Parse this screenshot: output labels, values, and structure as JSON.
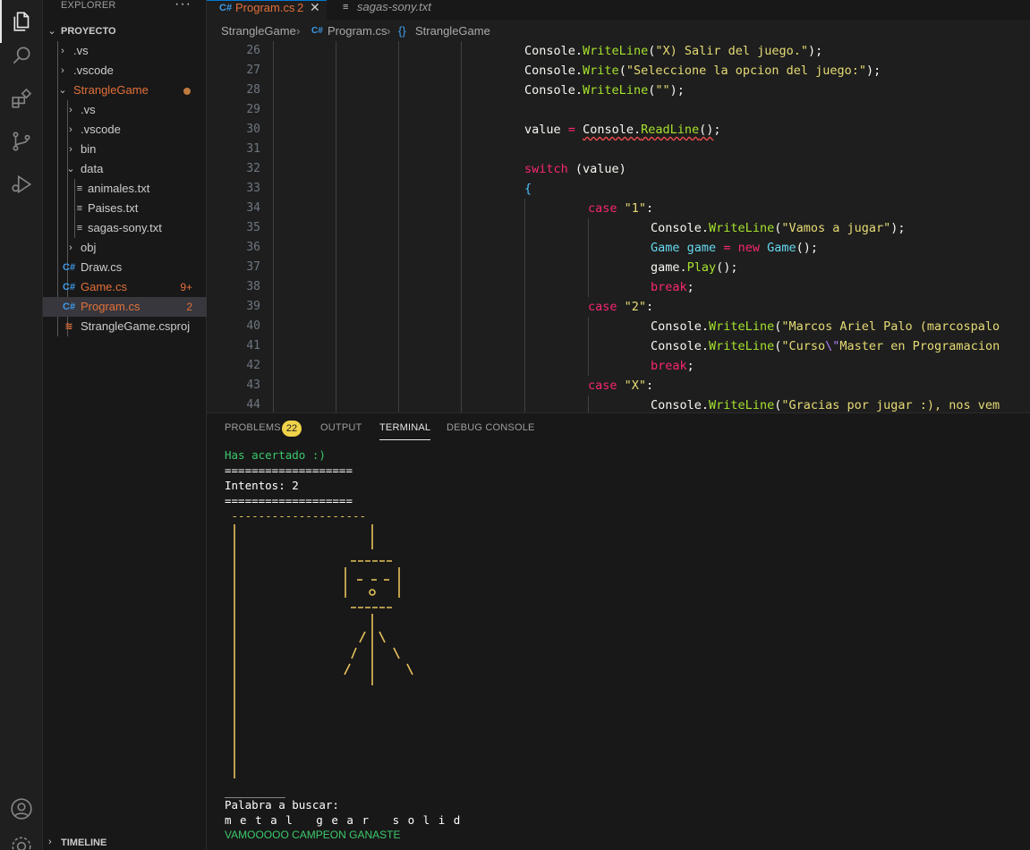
{
  "explorer": {
    "header": "EXPLORER",
    "more": "···",
    "section": "PROYECTO",
    "timeline": "TIMELINE",
    "tree": [
      {
        "label": ".vs",
        "type": "folder",
        "collapsed": true,
        "depth": 1
      },
      {
        "label": ".vscode",
        "type": "folder",
        "collapsed": true,
        "depth": 1
      },
      {
        "label": "StrangleGame",
        "type": "folder",
        "collapsed": false,
        "depth": 1,
        "modified": true
      },
      {
        "label": ".vs",
        "type": "folder",
        "collapsed": true,
        "depth": 2
      },
      {
        "label": ".vscode",
        "type": "folder",
        "collapsed": true,
        "depth": 2
      },
      {
        "label": "bin",
        "type": "folder",
        "collapsed": true,
        "depth": 2
      },
      {
        "label": "data",
        "type": "folder",
        "collapsed": false,
        "depth": 2
      },
      {
        "label": "animales.txt",
        "type": "txt",
        "depth": 3
      },
      {
        "label": "Paises.txt",
        "type": "txt",
        "depth": 3
      },
      {
        "label": "sagas-sony.txt",
        "type": "txt",
        "depth": 3
      },
      {
        "label": "obj",
        "type": "folder",
        "collapsed": true,
        "depth": 2
      },
      {
        "label": "Draw.cs",
        "type": "cs",
        "depth": 2
      },
      {
        "label": "Game.cs",
        "type": "cs",
        "depth": 2,
        "badge": "9+",
        "error": true
      },
      {
        "label": "Program.cs",
        "type": "cs",
        "depth": 2,
        "badge": "2",
        "error": true,
        "selected": true
      },
      {
        "label": "StrangleGame.csproj",
        "type": "rss",
        "depth": 2
      }
    ]
  },
  "tabs": [
    {
      "label": "Program.cs",
      "badge": "2",
      "active": true
    },
    {
      "label": "sagas-sony.txt",
      "active": false
    }
  ],
  "breadcrumb": [
    "StrangleGame",
    "Program.cs",
    "StrangleGame"
  ],
  "editor": {
    "line_numbers": [
      "26",
      "27",
      "28",
      "29",
      "30",
      "31",
      "32",
      "33",
      "34",
      "35",
      "36",
      "37",
      "38",
      "39",
      "40",
      "41",
      "42",
      "43",
      "44"
    ]
  },
  "panel": {
    "tabs": [
      "PROBLEMS",
      "OUTPUT",
      "TERMINAL",
      "DEBUG CONSOLE"
    ],
    "problems_count": "22",
    "active_tab": "TERMINAL",
    "terminal": {
      "line1": "Has acertado :)",
      "line2": "===================",
      "line3": "Intentos: 2",
      "line4": "===================",
      "gallows_top": " --------------------",
      "line_blank": "_________",
      "prompt": "Palabra a buscar:",
      "word": "m e t a l   g e a r   s o l i d",
      "win": "VAMOOOOO CAMPEON GANASTE"
    }
  },
  "colors": {
    "accent": "#0078d4",
    "error": "#e2703a",
    "badge": "#f0d24a",
    "terminal_green": "#3cc86b"
  }
}
